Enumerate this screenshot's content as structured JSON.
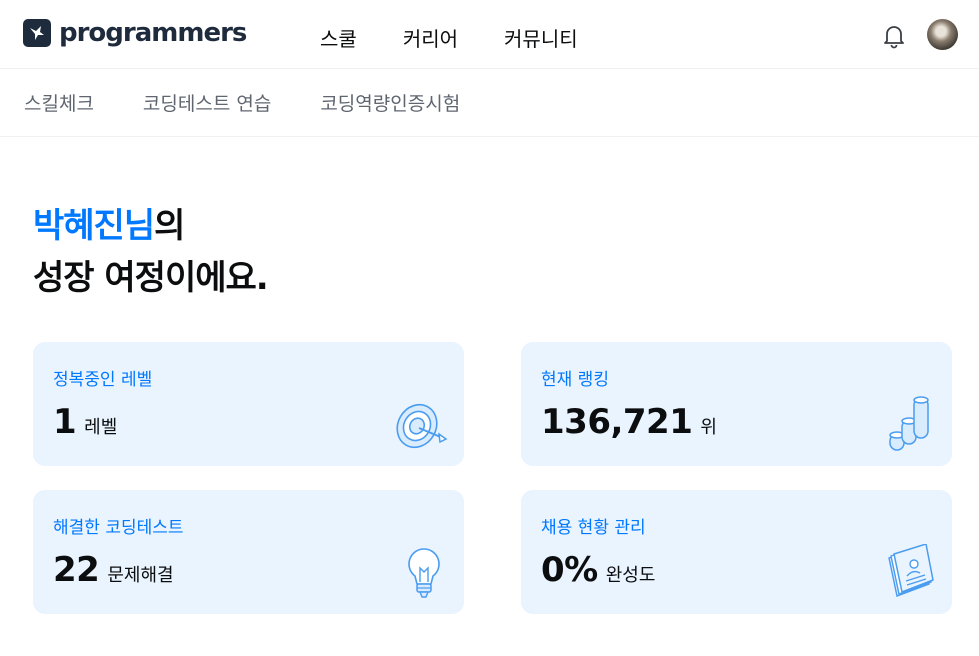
{
  "header": {
    "logo_text": "programmers",
    "nav": [
      "스쿨",
      "커리어",
      "커뮤니티"
    ],
    "icons": {
      "notification": "bell-icon",
      "profile": "avatar"
    }
  },
  "subnav": [
    "스킬체크",
    "코딩테스트 연습",
    "코딩역량인증시험"
  ],
  "greeting": {
    "name": "박혜진님",
    "suffix": "의",
    "line2": "성장 여정이에요."
  },
  "cards": [
    {
      "title": "정복중인 레벨",
      "value": "1",
      "unit": "레벨",
      "icon": "target-icon"
    },
    {
      "title": "현재 랭킹",
      "value": "136,721",
      "unit": "위",
      "icon": "coin-stack-icon"
    },
    {
      "title": "해결한 코딩테스트",
      "value": "22",
      "unit": "문제해결",
      "icon": "lightbulb-icon"
    },
    {
      "title": "채용 현황 관리",
      "value": "0%",
      "unit": "완성도",
      "icon": "resume-cards-icon"
    }
  ],
  "colors": {
    "accent": "#0078ff",
    "card_bg": "#eaf4fe",
    "logo": "#1e2b3c"
  }
}
